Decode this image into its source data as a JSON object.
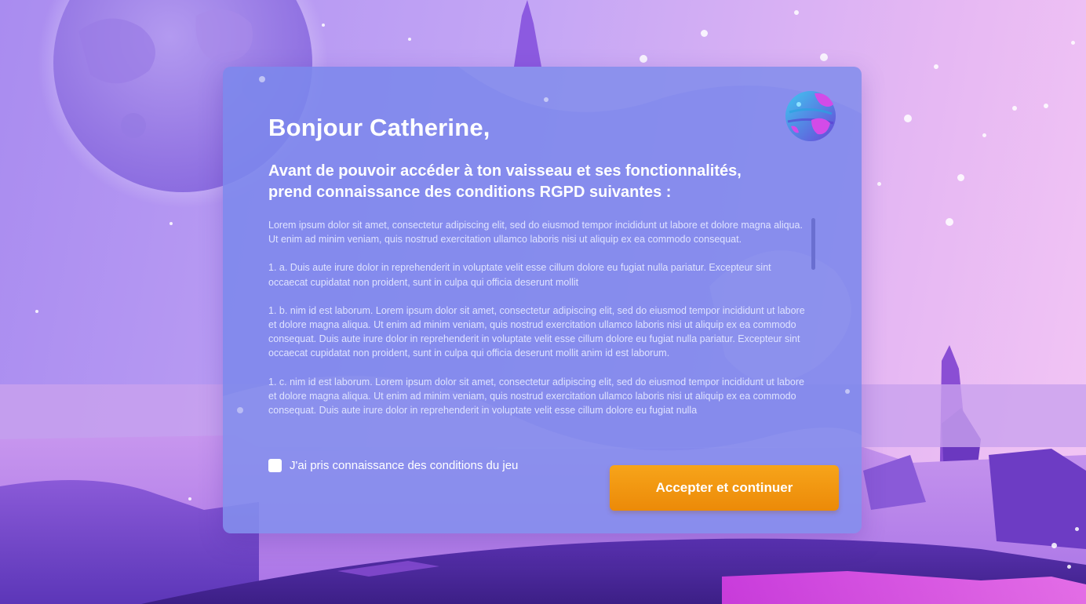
{
  "greeting": "Bonjour Catherine,",
  "subtitle": "Avant de pouvoir accéder à ton vaisseau et ses fonctionnalités, prend connaissance des conditions RGPD suivantes :",
  "terms": [
    "Lorem ipsum dolor sit amet, consectetur adipiscing elit, sed do eiusmod tempor incididunt ut labore et dolore magna aliqua. Ut enim ad minim veniam, quis nostrud exercitation ullamco laboris nisi ut aliquip ex ea commodo consequat.",
    "1. a. Duis aute irure dolor in reprehenderit in voluptate velit esse cillum dolore eu fugiat nulla pariatur. Excepteur sint occaecat cupidatat non proident, sunt in culpa qui officia deserunt mollit",
    "1. b. nim id est laborum. Lorem ipsum dolor sit amet, consectetur adipiscing elit, sed do eiusmod tempor incididunt ut labore et dolore magna aliqua. Ut enim ad minim veniam, quis nostrud exercitation ullamco laboris nisi ut aliquip ex ea commodo consequat. Duis aute irure dolor in reprehenderit in voluptate velit esse cillum dolore eu fugiat nulla pariatur. Excepteur sint occaecat cupidatat non proident, sunt in culpa qui officia deserunt mollit anim id est laborum.",
    "1. c. nim id est laborum. Lorem ipsum dolor sit amet, consectetur adipiscing elit, sed do eiusmod tempor incididunt ut labore et dolore magna aliqua. Ut enim ad minim veniam, quis nostrud exercitation ullamco laboris nisi ut aliquip ex ea commodo consequat. Duis aute irure dolor in reprehenderit in voluptate velit esse cillum dolore eu fugiat nulla"
  ],
  "consent": {
    "label": "J'ai pris connaissance des conditions du jeu",
    "checked": false
  },
  "accept_button": {
    "label": "Accepter et continuer"
  },
  "colors": {
    "accent": "#f29410",
    "card": "#7c88ec"
  },
  "icons": {
    "avatar": "planet-icon"
  }
}
